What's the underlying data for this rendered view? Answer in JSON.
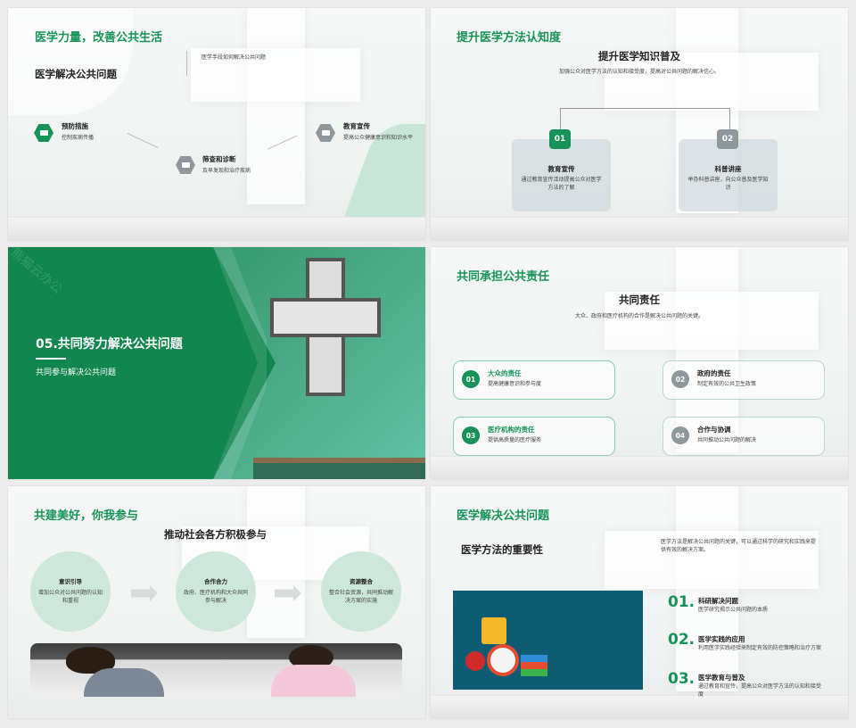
{
  "slide1": {
    "title": "医学力量，改善公共生活",
    "subtitle": "医学解决公共问题",
    "top_note": "医学手段如何解决公共问题",
    "items": [
      {
        "label": "预防措施",
        "desc": "控制疾病传播"
      },
      {
        "label": "筛查和诊断",
        "desc": "及早发现和治疗疾病"
      },
      {
        "label": "教育宣传",
        "desc": "提高公众健康意识和知识水平"
      }
    ]
  },
  "slide2": {
    "title": "提升医学方法认知度",
    "heading": "提升医学知识普及",
    "desc": "加强公众对医学方法的认知和接受度，提高对公共问题的解决信心。",
    "cards": [
      {
        "num": "01",
        "label": "教育宣传",
        "desc": "通过教育宣传活动提高公众对医学方法的了解"
      },
      {
        "num": "02",
        "label": "科普讲座",
        "desc": "举办科普讲座，向公众普及医学知识"
      }
    ]
  },
  "slide3": {
    "title": "05.共同努力解决公共问题",
    "subtitle": "共同参与解决公共问题",
    "watermark": "熊猫云办公"
  },
  "slide4": {
    "title": "共同承担公共责任",
    "heading": "共同责任",
    "desc": "大众、政府和医疗机构的合作是解决公共问题的关键。",
    "items": [
      {
        "num": "01",
        "label": "大众的责任",
        "desc": "提高健康意识和参与度"
      },
      {
        "num": "02",
        "label": "政府的责任",
        "desc": "制定有效的公共卫生政策"
      },
      {
        "num": "03",
        "label": "医疗机构的责任",
        "desc": "提供高质量的医疗服务"
      },
      {
        "num": "04",
        "label": "合作与协调",
        "desc": "共同推动公共问题的解决"
      }
    ]
  },
  "slide5": {
    "title": "共建美好，你我参与",
    "heading": "推动社会各方积极参与",
    "circles": [
      {
        "label": "意识引导",
        "desc": "增加公众对公共问题的认知和重视"
      },
      {
        "label": "合作合力",
        "desc": "政府、医疗机构和大众共同参与解决"
      },
      {
        "label": "资源整合",
        "desc": "整合社会资源，共同推动解决方案的实施"
      }
    ]
  },
  "slide6": {
    "title": "医学解决公共问题",
    "subtitle": "医学方法的重要性",
    "desc": "医学方法是解决公共问题的关键，可以通过科学的研究和实践来提供有效的解决方案。",
    "items": [
      {
        "num": "01.",
        "label": "科研解决问题",
        "desc": "医学研究揭示公共问题的本质"
      },
      {
        "num": "02.",
        "label": "医学实践的应用",
        "desc": "利用医学实践经验来制定有效的防控策略和治疗方案"
      },
      {
        "num": "03.",
        "label": "医学教育与普及",
        "desc": "通过教育和宣传，提高公众对医学方法的认知和接受度"
      }
    ]
  },
  "colors": {
    "primary": "#17935a",
    "gray": "#8e979c",
    "dark_teal": "#0d5c74"
  }
}
